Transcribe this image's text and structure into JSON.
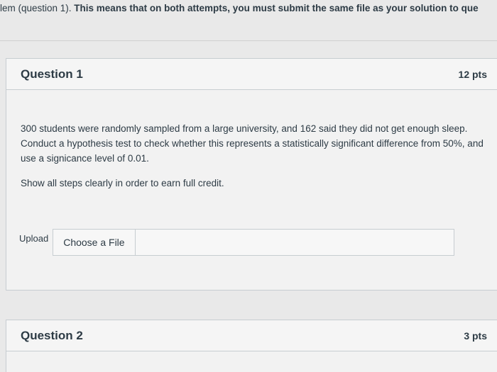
{
  "instructions": {
    "prefix": "lem (question 1). ",
    "bold_text": "This means that on both attempts, you must submit the same file as your solution to que"
  },
  "question1": {
    "title": "Question 1",
    "points": "12 pts",
    "body_text": "300 students were randomly sampled from a large university, and 162 said they did not get enough sleep. Conduct a hypothesis test to check whether this represents a statistically significant difference from 50%, and use a signicance level of 0.01.",
    "instruction_text": "Show all steps clearly in order to earn full credit.",
    "upload_label": "Upload",
    "choose_file_label": "Choose a File"
  },
  "question2": {
    "title": "Question 2",
    "points": "3 pts"
  }
}
